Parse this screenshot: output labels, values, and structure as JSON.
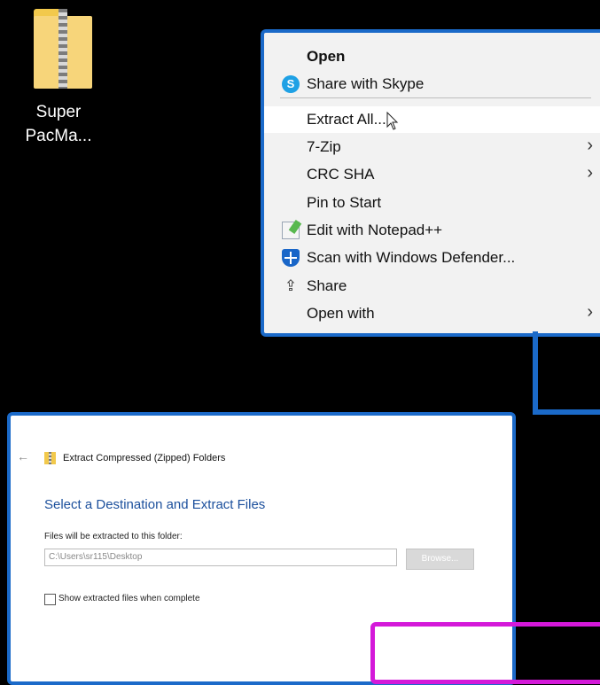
{
  "desktop_icon": {
    "label_line1": "Super",
    "label_line2": "PacMa..."
  },
  "context_menu": {
    "items": [
      {
        "label": "Open",
        "bold": true
      },
      {
        "label": "Share with Skype",
        "icon": "skype-icon"
      },
      {
        "label": "Extract All...",
        "highlighted": true
      },
      {
        "label": "7-Zip",
        "submenu": true
      },
      {
        "label": "CRC SHA",
        "submenu": true
      },
      {
        "label": "Pin to Start"
      },
      {
        "label": "Edit with Notepad++",
        "icon": "notepad-plus-plus-icon"
      },
      {
        "label": "Scan with Windows Defender...",
        "icon": "windows-defender-icon"
      },
      {
        "label": "Share",
        "icon": "share-icon"
      },
      {
        "label": "Open with",
        "submenu": true
      }
    ]
  },
  "dialog": {
    "back": "←",
    "title": "Extract Compressed (Zipped) Folders",
    "heading": "Select a Destination and Extract Files",
    "subheading": "Files will be extracted to this folder:",
    "path": "C:\\Users\\sr115\\Desktop",
    "browse_label": "Browse...",
    "checkbox_label": "Show extracted files when complete",
    "checkbox_checked": false
  },
  "colors": {
    "accent": "#1b6ac9",
    "highlight_frame": "#d419d9"
  }
}
